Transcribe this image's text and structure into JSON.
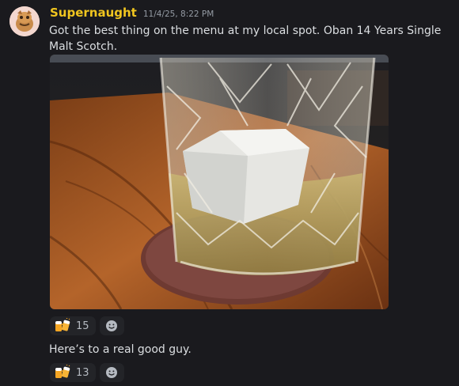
{
  "message": {
    "author": "Supernaught",
    "author_color": "#f0c51f",
    "timestamp": "11/4/25, 8:22 PM",
    "text": "Got the best thing on the menu at my local spot. Oban 14 Years Single Malt Scotch.",
    "attachment": {
      "kind": "photo",
      "icon": "whisky-glass-photo"
    },
    "reactions": [
      {
        "emoji": "beers-icon",
        "count": "15"
      }
    ]
  },
  "followup": {
    "text": "Here’s to a real good guy.",
    "reactions": [
      {
        "emoji": "beers-icon",
        "count": "13"
      }
    ]
  },
  "colors": {
    "background": "#1a1a1e",
    "text": "#dbdee1",
    "muted": "#949ba4",
    "reaction_bg": "#232428"
  }
}
